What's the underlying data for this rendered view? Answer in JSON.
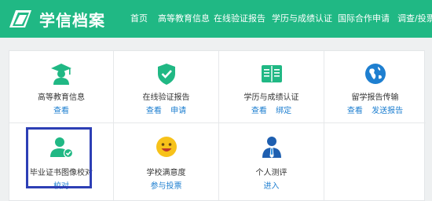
{
  "header": {
    "logo_text": "学信档案",
    "nav": [
      "首页",
      "高等教育信息",
      "在线验证报告",
      "学历与成绩认证",
      "国际合作申请",
      "调查/投票"
    ]
  },
  "colors": {
    "brand": "#20b884",
    "link": "#1e7fd0",
    "highlight": "#2d3fb5"
  },
  "cards": [
    {
      "icon": "graduate-icon",
      "title": "高等教育信息",
      "links": [
        "查看"
      ]
    },
    {
      "icon": "shield-check-icon",
      "title": "在线验证报告",
      "links": [
        "查看",
        "申请"
      ]
    },
    {
      "icon": "book-icon",
      "title": "学历与成绩认证",
      "links": [
        "查看",
        "绑定"
      ]
    },
    {
      "icon": "globe-icon",
      "title": "留学报告传输",
      "links": [
        "查看",
        "发送报告"
      ]
    },
    {
      "icon": "certificate-user-icon",
      "title": "毕业证书图像校对",
      "links": [
        "校对"
      ]
    },
    {
      "icon": "smiley-icon",
      "title": "学校满意度",
      "links": [
        "参与投票"
      ]
    },
    {
      "icon": "person-icon",
      "title": "个人测评",
      "links": [
        "进入"
      ]
    }
  ]
}
